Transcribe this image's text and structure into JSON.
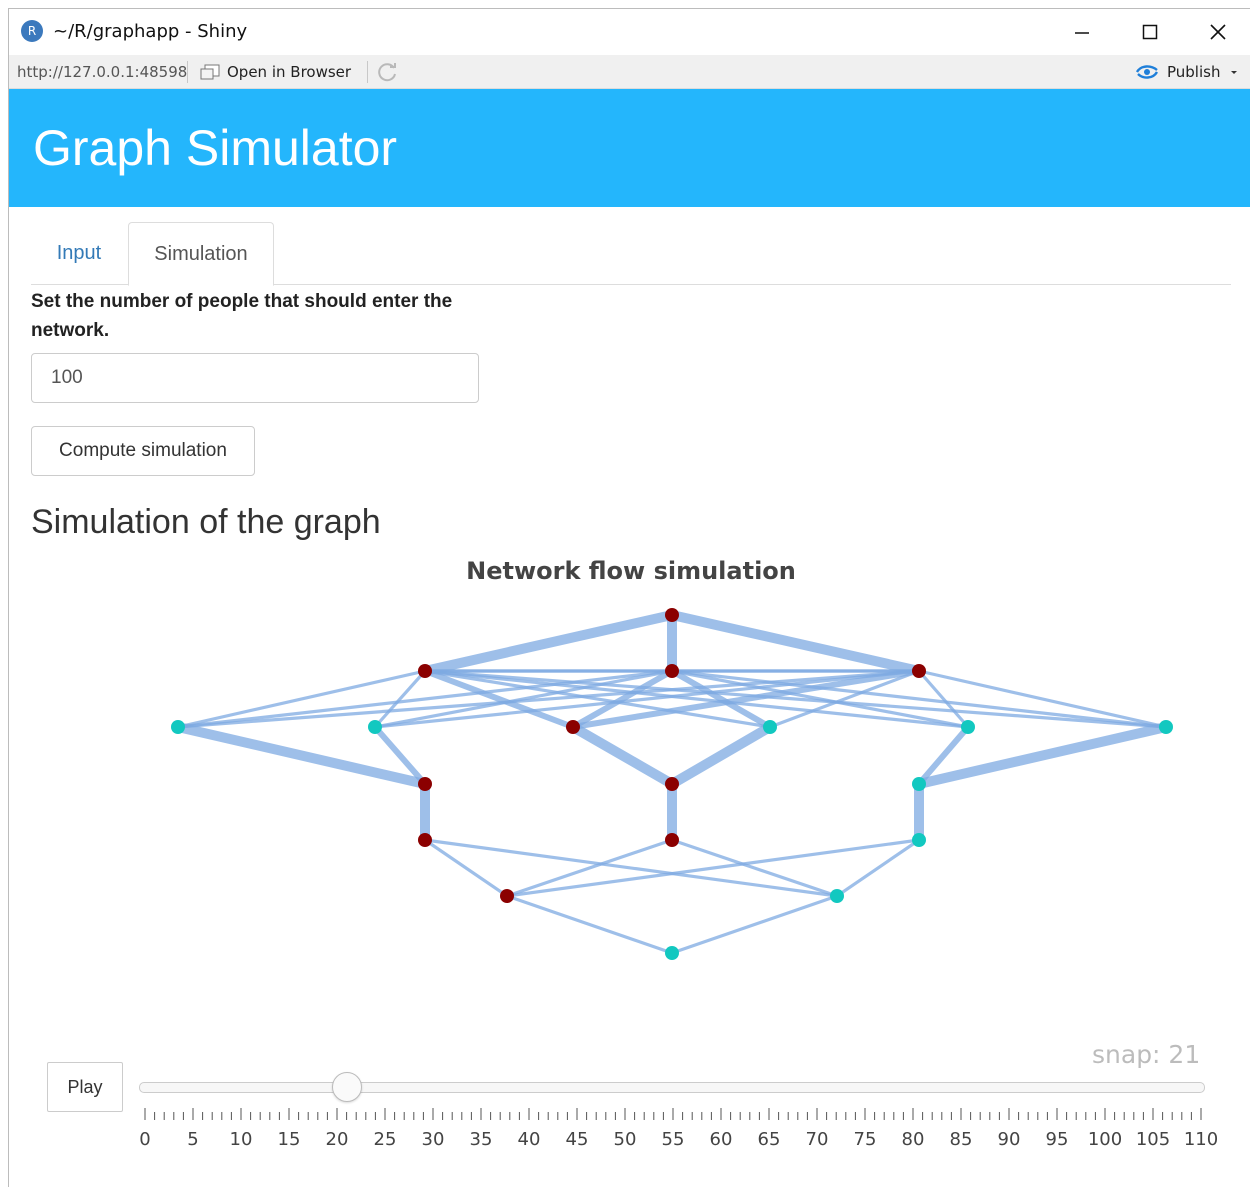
{
  "window": {
    "app_icon_letter": "R",
    "title": "~/R/graphapp - Shiny"
  },
  "toolbar": {
    "url": "http://127.0.0.1:48598",
    "open_in_browser": "Open in Browser",
    "publish": "Publish"
  },
  "app": {
    "title": "Graph Simulator"
  },
  "tabs": [
    {
      "label": "Input",
      "active": false
    },
    {
      "label": "Simulation",
      "active": true
    }
  ],
  "form": {
    "people_label": "Set the number of people that should enter the network.",
    "people_value": "100",
    "compute_button": "Compute simulation"
  },
  "section_title": "Simulation of the graph",
  "chart_data": {
    "type": "network",
    "title": "Network flow simulation",
    "colors": {
      "red_node": "#8b0000",
      "teal_node": "#12c8c0",
      "edge": "#7ea9e1",
      "edge_dark": "#3f86de"
    },
    "nodes": [
      {
        "id": "A",
        "color": "red"
      },
      {
        "id": "B",
        "color": "red"
      },
      {
        "id": "C",
        "color": "red"
      },
      {
        "id": "D",
        "color": "red"
      },
      {
        "id": "E",
        "color": "teal"
      },
      {
        "id": "F",
        "color": "teal"
      },
      {
        "id": "G",
        "color": "red"
      },
      {
        "id": "H",
        "color": "teal"
      },
      {
        "id": "I",
        "color": "teal"
      },
      {
        "id": "J",
        "color": "teal"
      },
      {
        "id": "K",
        "color": "red"
      },
      {
        "id": "L",
        "color": "red"
      },
      {
        "id": "M",
        "color": "teal"
      },
      {
        "id": "N",
        "color": "red"
      },
      {
        "id": "O",
        "color": "red"
      },
      {
        "id": "P",
        "color": "teal"
      },
      {
        "id": "Q",
        "color": "red"
      },
      {
        "id": "R",
        "color": "teal"
      },
      {
        "id": "S",
        "color": "teal"
      }
    ],
    "edges": [
      {
        "s": "A",
        "t": "B",
        "w": 3
      },
      {
        "s": "A",
        "t": "C",
        "w": 3
      },
      {
        "s": "A",
        "t": "D",
        "w": 3
      },
      {
        "s": "B",
        "t": "E",
        "w": 1
      },
      {
        "s": "B",
        "t": "F",
        "w": 1
      },
      {
        "s": "B",
        "t": "G",
        "w": 2
      },
      {
        "s": "B",
        "t": "H",
        "w": 1
      },
      {
        "s": "B",
        "t": "I",
        "w": 1
      },
      {
        "s": "B",
        "t": "J",
        "w": 1
      },
      {
        "s": "B",
        "t": "C",
        "w": 1
      },
      {
        "s": "B",
        "t": "D",
        "w": 1
      },
      {
        "s": "C",
        "t": "E",
        "w": 1
      },
      {
        "s": "C",
        "t": "F",
        "w": 1
      },
      {
        "s": "C",
        "t": "G",
        "w": 2
      },
      {
        "s": "C",
        "t": "H",
        "w": 2
      },
      {
        "s": "C",
        "t": "I",
        "w": 1
      },
      {
        "s": "C",
        "t": "J",
        "w": 1
      },
      {
        "s": "C",
        "t": "D",
        "w": 1
      },
      {
        "s": "D",
        "t": "E",
        "w": 1
      },
      {
        "s": "D",
        "t": "F",
        "w": 1
      },
      {
        "s": "D",
        "t": "G",
        "w": 2
      },
      {
        "s": "D",
        "t": "H",
        "w": 1
      },
      {
        "s": "D",
        "t": "I",
        "w": 1
      },
      {
        "s": "D",
        "t": "J",
        "w": 1
      },
      {
        "s": "E",
        "t": "K",
        "w": 3
      },
      {
        "s": "F",
        "t": "K",
        "w": 2
      },
      {
        "s": "G",
        "t": "L",
        "w": 3
      },
      {
        "s": "H",
        "t": "L",
        "w": 3
      },
      {
        "s": "I",
        "t": "M",
        "w": 2
      },
      {
        "s": "J",
        "t": "M",
        "w": 3
      },
      {
        "s": "K",
        "t": "N",
        "w": 3
      },
      {
        "s": "L",
        "t": "O",
        "w": 3
      },
      {
        "s": "M",
        "t": "P",
        "w": 3
      },
      {
        "s": "N",
        "t": "Q",
        "w": 1
      },
      {
        "s": "N",
        "t": "R",
        "w": 1
      },
      {
        "s": "O",
        "t": "Q",
        "w": 1
      },
      {
        "s": "O",
        "t": "R",
        "w": 1
      },
      {
        "s": "P",
        "t": "Q",
        "w": 1
      },
      {
        "s": "P",
        "t": "R",
        "w": 1
      },
      {
        "s": "Q",
        "t": "S",
        "w": 1
      },
      {
        "s": "R",
        "t": "S",
        "w": 1
      }
    ]
  },
  "player": {
    "play_label": "Play",
    "snap_text": "snap: 21",
    "snap_value": 21,
    "min": 0,
    "max": 110,
    "ticks": [
      "0",
      "5",
      "10",
      "15",
      "20",
      "25",
      "30",
      "35",
      "40",
      "45",
      "50",
      "55",
      "60",
      "65",
      "70",
      "75",
      "80",
      "85",
      "90",
      "95",
      "100",
      "105",
      "110"
    ]
  }
}
